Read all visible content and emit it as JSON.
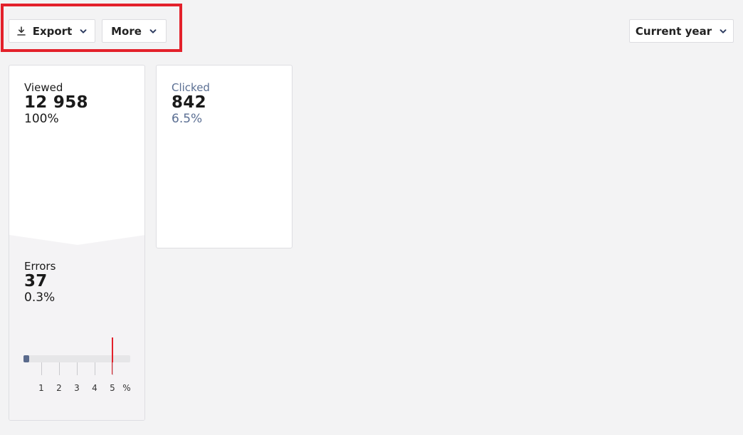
{
  "toolbar": {
    "export_label": "Export",
    "more_label": "More",
    "period_label": "Current year"
  },
  "metrics": {
    "viewed": {
      "label": "Viewed",
      "value": "12 958",
      "percent": "100%"
    },
    "clicked": {
      "label": "Clicked",
      "value": "842",
      "percent": "6.5%"
    },
    "errors": {
      "label": "Errors",
      "value": "37",
      "percent": "0.3%"
    }
  },
  "gauge": {
    "ticks": [
      "1",
      "2",
      "3",
      "4",
      "5"
    ],
    "unit": "%",
    "max": 6,
    "value_percent": 0.3,
    "threshold_percent": 5
  },
  "colors": {
    "highlight": "#e3212b",
    "accent": "#5a6a8c",
    "threshold": "#e3212b"
  }
}
